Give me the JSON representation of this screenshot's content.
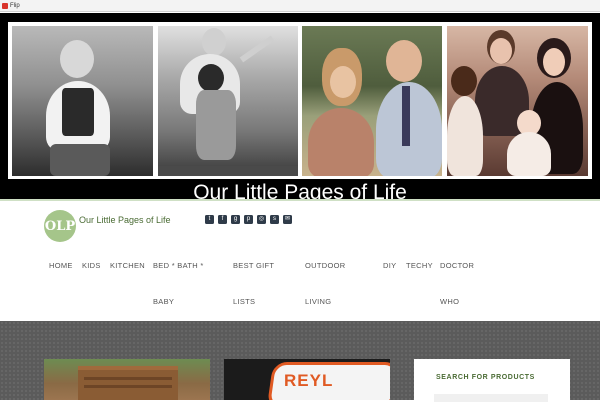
{
  "browser": {
    "tab_title": "Flip"
  },
  "banner": {
    "title": "Our Little Pages of Life"
  },
  "header": {
    "logo_initials": "OLP",
    "site_name": "Our Little Pages of Life",
    "social_icons": [
      "twitter-icon",
      "facebook-icon",
      "google-plus-icon",
      "pinterest-icon",
      "instagram-icon",
      "stumbleupon-icon",
      "email-icon"
    ]
  },
  "nav": {
    "items": [
      {
        "label_lines": [
          "HOME"
        ]
      },
      {
        "label_lines": [
          "KIDS"
        ]
      },
      {
        "label_lines": [
          "KITCHEN"
        ]
      },
      {
        "label_lines": [
          "BED * BATH *",
          "BABY"
        ]
      },
      {
        "label_lines": [
          "BEST GIFT",
          "LISTS"
        ]
      },
      {
        "label_lines": [
          "OUTDOOR",
          "LIVING"
        ]
      },
      {
        "label_lines": [
          "DIY"
        ]
      },
      {
        "label_lines": [
          "TECHY"
        ]
      },
      {
        "label_lines": [
          "DOCTOR",
          "WHO"
        ]
      }
    ]
  },
  "content": {
    "card2_logo_text": "REYL",
    "sidebar": {
      "search_title": "SEARCH FOR PRODUCTS"
    }
  }
}
